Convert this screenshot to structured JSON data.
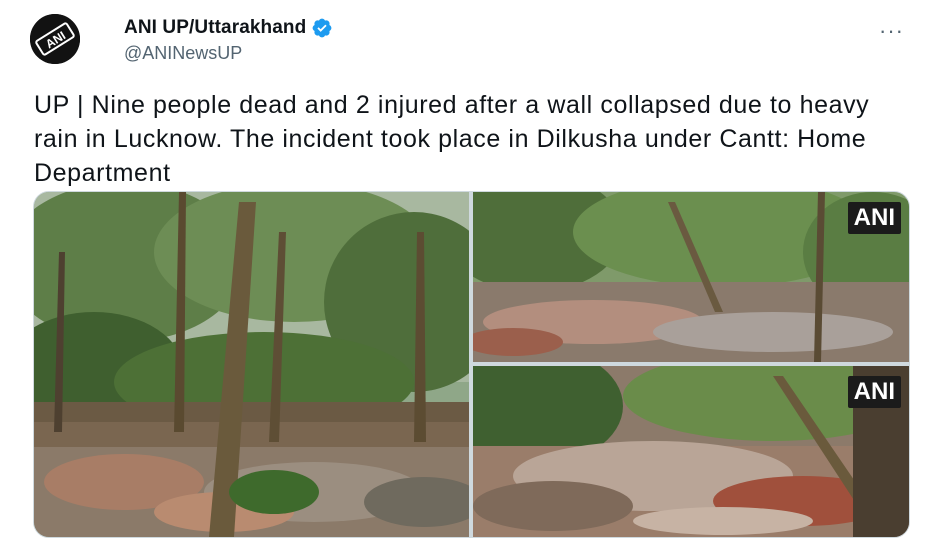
{
  "account": {
    "display_name": "ANI UP/Uttarakhand",
    "handle": "@ANINewsUP",
    "avatar_text": "ANI",
    "verified": true
  },
  "menu": {
    "more_label": "···"
  },
  "tweet": {
    "text": "UP | Nine people dead and 2 injured after a wall collapsed due to heavy rain in Lucknow. The incident took place in Dilkusha under Cantt: Home Department"
  },
  "media": {
    "watermark_top_right": "ANI",
    "watermark_bottom_right": "ANI"
  },
  "colors": {
    "text": "#0f1419",
    "secondary": "#536471",
    "verified_badge": "#1d9bf0",
    "border": "#cfd9de"
  },
  "icons": [
    "avatar-logo",
    "verified-badge-icon",
    "more-options-icon"
  ]
}
